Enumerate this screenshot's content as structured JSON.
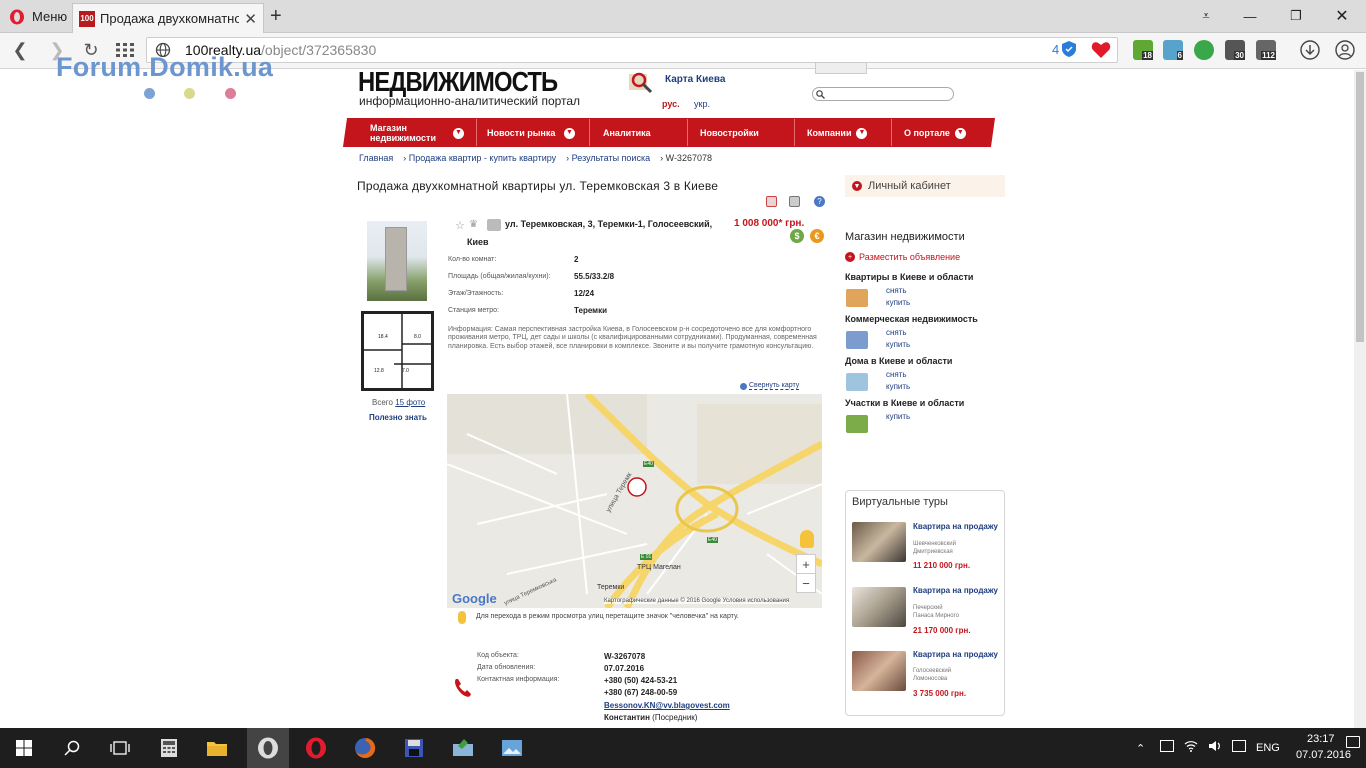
{
  "browser": {
    "menu_label": "Меню",
    "tab_title": "Продажа двухкомнатной",
    "tab_favicon": "100",
    "url_host": "100realty.ua",
    "url_path": "/object/372365830",
    "tracker_count": "4",
    "extension_badges": [
      "18",
      "6",
      "30",
      "112"
    ]
  },
  "watermark": "Forum.Domik.ua",
  "site": {
    "logo": "НЕДВИЖИМОСТЬ",
    "logo_sub": "информационно-аналитический портал",
    "map_link": "Карта Киева",
    "lang_rus": "рус.",
    "lang_ukr": "укр."
  },
  "nav": [
    {
      "label": "Магазин недвижимости"
    },
    {
      "label": "Новости рынка"
    },
    {
      "label": "Аналитика"
    },
    {
      "label": "Новостройки"
    },
    {
      "label": "Компании"
    },
    {
      "label": "О портале"
    }
  ],
  "breadcrumb": [
    "Главная",
    "› Продажа квартир - купить квартиру",
    "› Результаты поиска",
    "› W-3267078"
  ],
  "listing": {
    "title": "Продажа двухкомнатной квартиры ул. Теремковская 3 в Киеве",
    "address": "ул. Теремковская, 3, Теремки-1, Голосеевский,",
    "city": "Киев",
    "price": "1 008 000* грн.",
    "props": [
      {
        "label": "Кол-во комнат:",
        "value": "2"
      },
      {
        "label": "Площадь (общая/жилая/кухни):",
        "value": "55.5/33.2/8"
      },
      {
        "label": "Этаж/Этажность:",
        "value": "12/24"
      },
      {
        "label": "Станция метро:",
        "value": "Теремки"
      }
    ],
    "info": "Информация: Самая перспективная застройка Киева, в Голосеевском р-н сосредоточено все для комфортного проживания метро, ТРЦ, дет сады и школы (с квалифицированными сотрудниками). Продуманная, современная планировка. Есть выбор этажей, все планировки в комплексе. Звоните и вы получите грамотную консультацию.",
    "photos_total_prefix": "Всего",
    "photos_total_link": "15 фото",
    "useful_link": "Полезно знать",
    "collapse_map": "Свернуть карту",
    "plan_labels": [
      "18.4",
      "8.0",
      "12.8",
      "7.0"
    ],
    "map": {
      "labels": [
        "улица Теремк",
        "ТРЦ Магелан",
        "Теремки",
        "улица Теремковська",
        "E40",
        "E40",
        "E 01"
      ],
      "google": "Google",
      "copyright": "Картографические данные © 2016 Google    Условия использования",
      "zoom_in": "+",
      "zoom_out": "−"
    },
    "street_hint": "Для перехода в режим просмотра улиц перетащите значок \"человечка\" на карту.",
    "contacts": [
      {
        "label": "Код объекта:",
        "value": "W-3267078"
      },
      {
        "label": "Дата обновления:",
        "value": "07.07.2016"
      },
      {
        "label": "Контактная информация:",
        "value": "+380 (50) 424-53-21"
      }
    ],
    "phone2": "+380 (67) 248-00-59",
    "email": "Bessonov.KN@vv.blagovest.com",
    "contact_name": "Константин",
    "contact_role": "(Посредник)"
  },
  "sidebar": {
    "cabinet": "Личный кабинет",
    "shop_title": "Магазин недвижимости",
    "place_ad": "Разместить объявление",
    "categories": [
      {
        "title": "Квартиры в Киеве и области",
        "links": [
          "снять",
          "купить"
        ]
      },
      {
        "title": "Коммерческая недвижимость",
        "links": [
          "снять",
          "купить"
        ]
      },
      {
        "title": "Дома в Киеве и области",
        "links": [
          "снять",
          "купить"
        ]
      },
      {
        "title": "Участки в Киеве и области",
        "links": [
          "купить"
        ]
      }
    ],
    "tours_title": "Виртуальные туры",
    "tours": [
      {
        "name": "Квартира на продажу",
        "loc1": "Шевченковский",
        "loc2": "Дмитриевская",
        "price": "11 210 000 грн."
      },
      {
        "name": "Квартира на продажу",
        "loc1": "Печерский",
        "loc2": "Панаса Мирного",
        "price": "21 170 000 грн."
      },
      {
        "name": "Квартира на продажу",
        "loc1": "Голосеевский",
        "loc2": "Ломоносова",
        "price": "3 735 000 грн."
      }
    ]
  },
  "taskbar": {
    "lang": "ENG",
    "time": "23:17",
    "date": "07.07.2016"
  },
  "colors": {
    "brand_red": "#c4151c",
    "link_blue": "#1f3e80",
    "watermark_blue": "#6b96cf"
  }
}
